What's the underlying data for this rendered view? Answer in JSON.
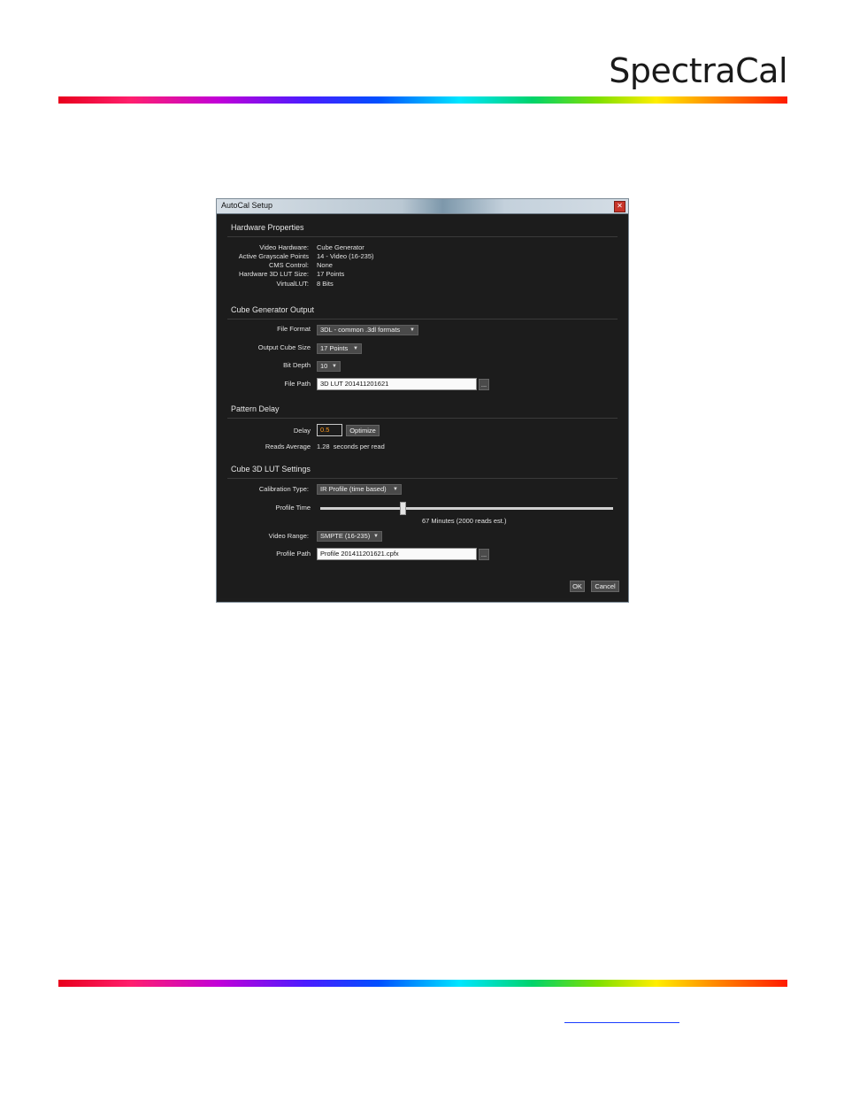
{
  "brand": {
    "logo_text": "SpectraCal"
  },
  "dialog": {
    "title": "AutoCal Setup",
    "close_glyph": "✕",
    "hardware": {
      "heading": "Hardware Properties",
      "rows": [
        {
          "label": "Video Hardware:",
          "value": "Cube Generator"
        },
        {
          "label": "Active Grayscale Points",
          "value": "14 - Video (16-235)"
        },
        {
          "label": "CMS Control:",
          "value": "None"
        },
        {
          "label": "Hardware 3D LUT Size:",
          "value": "17 Points"
        },
        {
          "label": "VirtualLUT:",
          "value": "8 Bits"
        }
      ]
    },
    "cube_output": {
      "heading": "Cube Generator Output",
      "file_format_label": "File Format",
      "file_format_value": "3DL - common .3dl formats",
      "cube_size_label": "Output Cube Size",
      "cube_size_value": "17 Points",
      "bit_depth_label": "Bit Depth",
      "bit_depth_value": "10",
      "file_path_label": "File Path",
      "file_path_value": "3D LUT 201411201621",
      "browse_label": "..."
    },
    "pattern_delay": {
      "heading": "Pattern Delay",
      "delay_label": "Delay",
      "delay_value": "0.5",
      "optimize_label": "Optimize",
      "reads_label": "Reads Average",
      "reads_value": "1.28",
      "reads_unit": "seconds per read"
    },
    "lut_settings": {
      "heading": "Cube 3D LUT Settings",
      "calibration_label": "Calibration Type:",
      "calibration_value": "IR Profile (time based)",
      "profile_time_label": "Profile Time",
      "profile_time_fraction": 0.28,
      "profile_time_text": "67 Minutes (2000 reads est.)",
      "video_range_label": "Video Range:",
      "video_range_value": "SMPTE (16-235)",
      "profile_path_label": "Profile Path",
      "profile_path_value": "Profile 201411201621.cpfx",
      "browse_label": "..."
    },
    "ok_label": "OK",
    "cancel_label": "Cancel"
  },
  "colors": {
    "dialog_bg": "#1d1d1d",
    "delay_text": "#ff9a1e",
    "link_underline": "#1a3cff"
  }
}
